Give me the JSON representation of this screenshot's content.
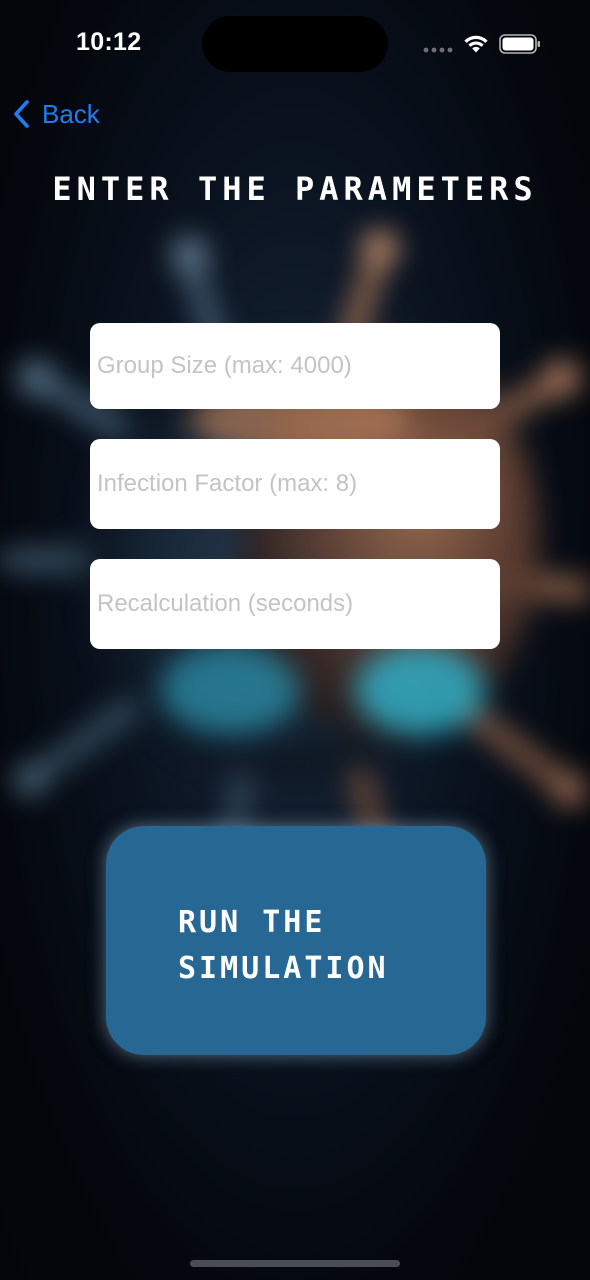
{
  "status_bar": {
    "time": "10:12",
    "wifi_icon": "wifi-icon",
    "battery_icon": "battery-icon"
  },
  "nav": {
    "back_label": "Back",
    "back_icon": "chevron-left-icon"
  },
  "title": "ENTER THE PARAMETERS",
  "form": {
    "group_size": {
      "value": "",
      "placeholder": "Group Size (max: 4000)"
    },
    "infection_factor": {
      "value": "",
      "placeholder": "Infection Factor (max: 8)"
    },
    "recalculation": {
      "value": "",
      "placeholder": "Recalculation (seconds)"
    }
  },
  "run_button": {
    "label": "RUN THE SIMULATION"
  },
  "colors": {
    "accent": "#1f7df0",
    "button": "#266793",
    "field_bg": "#ffffff",
    "placeholder": "#c3c3c8"
  }
}
